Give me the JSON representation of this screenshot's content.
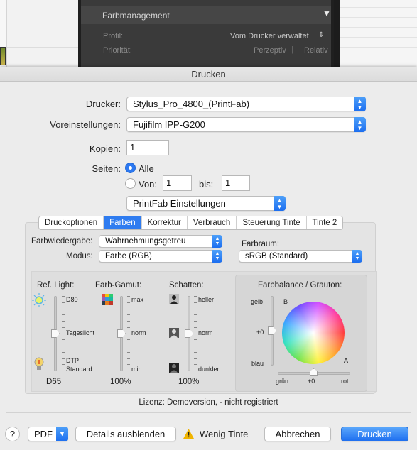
{
  "background": {
    "panel_title": "Farbmanagement",
    "profil_label": "Profil:",
    "profil_value": "Vom Drucker verwaltet",
    "prioritaet_label": "Priorität:",
    "perzeptiv": "Perzeptiv",
    "relativ": "Relativ"
  },
  "dialog": {
    "title": "Drucken",
    "printer_label": "Drucker:",
    "printer_value": "Stylus_Pro_4800_(PrintFab)",
    "presets_label": "Voreinstellungen:",
    "presets_value": "Fujifilm IPP-G200",
    "copies_label": "Kopien:",
    "copies_value": "1",
    "pages_label": "Seiten:",
    "pages_all": "Alle",
    "pages_from_label": "Von:",
    "pages_from_value": "1",
    "pages_to_label": "bis:",
    "pages_to_value": "1",
    "section_value": "PrintFab Einstellungen"
  },
  "tabs": [
    {
      "label": "Druckoptionen",
      "active": false
    },
    {
      "label": "Farben",
      "active": true
    },
    {
      "label": "Korrektur",
      "active": false
    },
    {
      "label": "Verbrauch",
      "active": false
    },
    {
      "label": "Steuerung Tinte",
      "active": false
    },
    {
      "label": "Tinte 2",
      "active": false
    }
  ],
  "farben": {
    "rendering_label": "Farbwiedergabe:",
    "rendering_value": "Wahrnehmungsgetreu",
    "mode_label": "Modus:",
    "mode_value": "Farbe (RGB)",
    "colorspace_label": "Farbraum:",
    "colorspace_value": "sRGB (Standard)"
  },
  "sliders": {
    "light": {
      "title": "Ref. Light:",
      "top": "D80",
      "mid": "Tageslicht",
      "bot1": "DTP",
      "bot2": "Standard",
      "value": "D65",
      "icon_top": "sun-icon",
      "icon_bottom": "bulb-icon",
      "level": 0.5
    },
    "gamut": {
      "title": "Farb-Gamut:",
      "top": "max",
      "mid": "norm",
      "bot": "min",
      "value": "100%",
      "icon_top": "color-grid-icon",
      "level": 0.5
    },
    "shadow": {
      "title": "Schatten:",
      "top": "heller",
      "mid": "norm",
      "bot": "dunkler",
      "value": "100%",
      "icon_top": "portrait-light-icon",
      "icon_mid": "portrait-mid-icon",
      "icon_bottom": "portrait-dark-icon",
      "level": 0.5
    }
  },
  "balance": {
    "title": "Farbbalance / Grauton:",
    "gelb": "gelb",
    "plus0_v": "+0",
    "blau": "blau",
    "b": "B",
    "a": "A",
    "gruen": "grün",
    "plus0_h": "+0",
    "rot": "rot"
  },
  "license": "Lizenz: Demoversion,  - nicht registriert",
  "bottom": {
    "help": "?",
    "pdf": "PDF",
    "details": "Details ausblenden",
    "warning": "Wenig Tinte",
    "cancel": "Abbrechen",
    "print": "Drucken"
  },
  "colors": {
    "accent": "#2f7cf0",
    "warning": "#f0b400"
  }
}
